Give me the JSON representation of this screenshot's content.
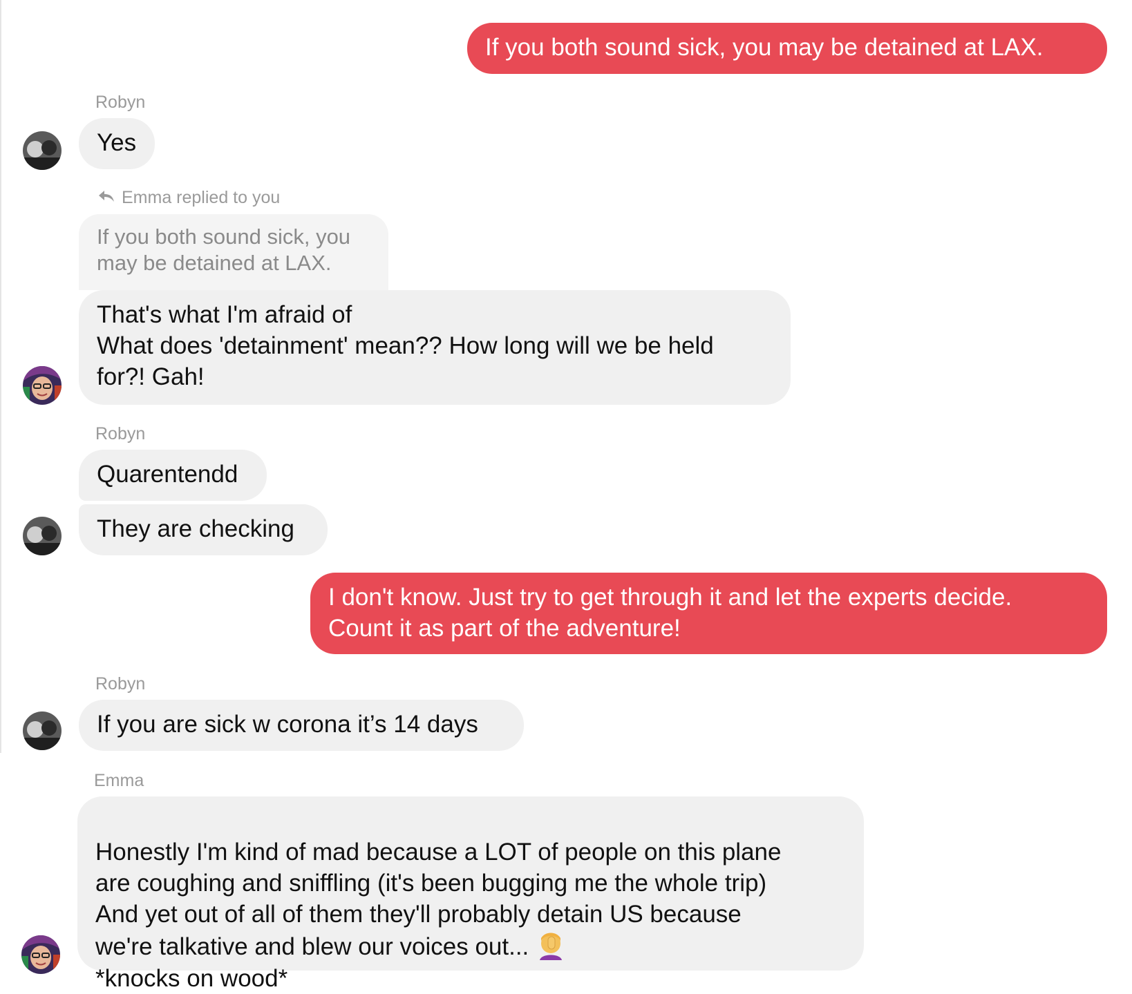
{
  "colors": {
    "outgoing": "#e84a55",
    "incoming": "#f0f0f0",
    "meta_text": "#9a9a9a"
  },
  "conversation": {
    "msg1": "If you both sound sick, you may be detained at LAX.",
    "robyn_label_1": "Robyn",
    "msg2": "Yes",
    "reply_note": "Emma replied to you",
    "reply_icon": "reply-arrow-icon",
    "quoted": "If you both sound sick, you\nmay be detained at LAX.",
    "msg3": "That's what I'm afraid of\nWhat does 'detainment' mean?? How long will we be held\nfor?! Gah!",
    "robyn_label_2": "Robyn",
    "msg4": "Quarentendd",
    "msg5": "They are checking",
    "msg6": "I don't know. Just try to get through it and let the experts decide.\nCount it as part of the adventure!",
    "robyn_label_3": "Robyn",
    "msg7": "If you are sick w corona it’s 14 days",
    "emma_label": "Emma",
    "msg8_text": "Honestly I'm kind of mad because a LOT of people on this plane\nare coughing and sniffling (it's been bugging me the whole trip)\nAnd yet out of all of them they'll probably detain US because\nwe're talkative and blew our voices out... ",
    "msg8_emoji": "facepalm-emoji",
    "msg8_tail": "\n*knocks on wood*"
  }
}
